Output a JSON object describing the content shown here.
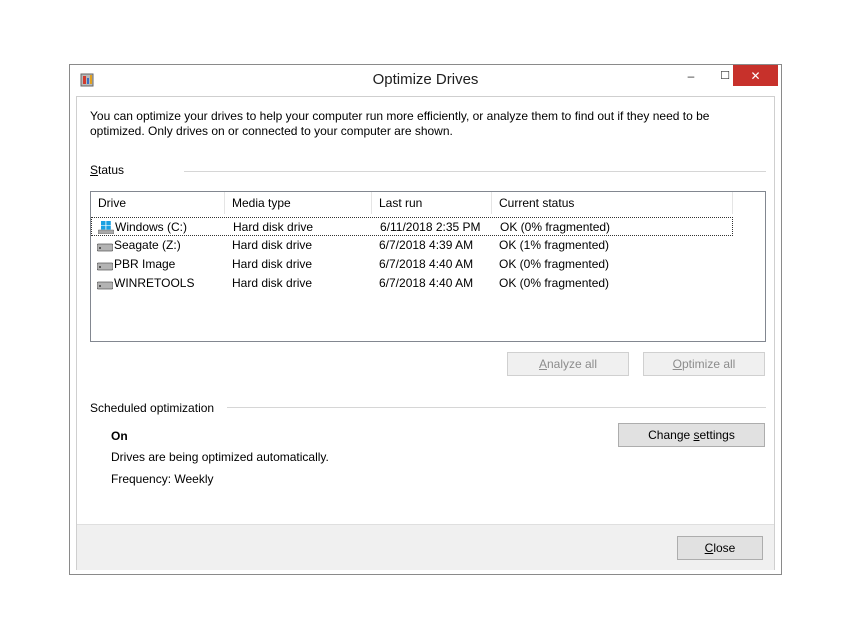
{
  "window": {
    "title": "Optimize Drives",
    "minimize_glyph": "–",
    "maximize_glyph": "☐",
    "close_glyph": "✕"
  },
  "intro_text": "You can optimize your drives to help your computer run more efficiently, or analyze them to find out if they need to be optimized. Only drives on or connected to your computer are shown.",
  "status": {
    "label_accel": "S",
    "label_rest": "tatus",
    "columns": [
      "Drive",
      "Media type",
      "Last run",
      "Current status"
    ],
    "drives": [
      {
        "name": "Windows (C:)",
        "media": "Hard disk drive",
        "last_run": "6/11/2018 2:35 PM",
        "status": "OK (0% fragmented)",
        "icon": "windows-drive-icon"
      },
      {
        "name": "Seagate (Z:)",
        "media": "Hard disk drive",
        "last_run": "6/7/2018 4:39 AM",
        "status": "OK (1% fragmented)",
        "icon": "hard-drive-icon"
      },
      {
        "name": "PBR Image",
        "media": "Hard disk drive",
        "last_run": "6/7/2018 4:40 AM",
        "status": "OK (0% fragmented)",
        "icon": "hard-drive-icon"
      },
      {
        "name": "WINRETOOLS",
        "media": "Hard disk drive",
        "last_run": "6/7/2018 4:40 AM",
        "status": "OK (0% fragmented)",
        "icon": "hard-drive-icon"
      }
    ]
  },
  "buttons": {
    "analyze_accel": "A",
    "analyze_rest": "nalyze all",
    "optimize_accel": "O",
    "optimize_rest": "ptimize all",
    "change_pre": "Change ",
    "change_accel": "s",
    "change_rest": "ettings",
    "close_accel": "C",
    "close_rest": "lose"
  },
  "schedule": {
    "label": "Scheduled optimization",
    "state": "On",
    "description": "Drives are being optimized automatically.",
    "frequency": "Frequency: Weekly"
  },
  "colors": {
    "close_button": "#c7312b",
    "footer": "#f0f0f0"
  }
}
